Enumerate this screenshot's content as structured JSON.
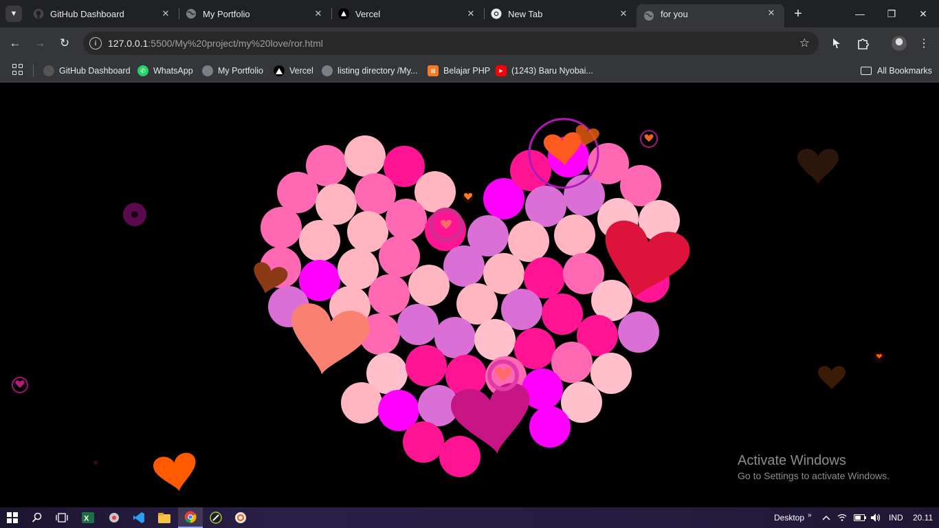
{
  "tabs": [
    {
      "title": "GitHub Dashboard",
      "icon": "github-icon",
      "active": false
    },
    {
      "title": "My Portfolio",
      "icon": "globe-icon",
      "active": false
    },
    {
      "title": "Vercel",
      "icon": "vercel-icon",
      "active": false
    },
    {
      "title": "New Tab",
      "icon": "chrome-icon",
      "active": false
    },
    {
      "title": "for you",
      "icon": "globe-icon",
      "active": true
    }
  ],
  "tab_close_glyph": "✕",
  "new_tab_glyph": "+",
  "window_controls": {
    "minimize": "—",
    "maximize": "❐",
    "close": "✕"
  },
  "toolbar": {
    "back_glyph": "←",
    "forward_glyph": "→",
    "reload_glyph": "↻",
    "url_host": "127.0.0.1",
    "url_rest": ":5500/My%20project/my%20love/ror.html",
    "star_glyph": "☆",
    "menu_glyph": "⋮",
    "site_info_glyph": "i"
  },
  "bookmarks": [
    {
      "label": "GitHub Dashboard",
      "icon": "github-icon"
    },
    {
      "label": "WhatsApp",
      "icon": "whatsapp-icon"
    },
    {
      "label": "My Portfolio",
      "icon": "globe-icon"
    },
    {
      "label": "Vercel",
      "icon": "vercel-icon"
    },
    {
      "label": "listing directory /My...",
      "icon": "globe-icon"
    },
    {
      "label": "Belajar PHP",
      "icon": "xampp-icon"
    },
    {
      "label": "(1243) Baru Nyobai...",
      "icon": "youtube-icon"
    }
  ],
  "all_bookmarks_label": "All Bookmarks",
  "watermark": {
    "title": "Activate Windows",
    "subtitle": "Go to Settings to activate Windows."
  },
  "taskbar": {
    "apps": [
      "windows-start-icon",
      "search-icon",
      "task-view-icon",
      "excel-icon",
      "app-icon",
      "vscode-icon",
      "file-explorer-icon",
      "chrome-icon",
      "app-icon",
      "app-icon"
    ],
    "desktop_label": "Desktop",
    "language": "IND",
    "time": "20.11"
  },
  "colors": {
    "tab_strip": "#202124",
    "toolbar": "#35363a",
    "page_bg": "#000000",
    "heart_palette": [
      "#ff1493",
      "#ff69b4",
      "#ffb6c1",
      "#ff00ff",
      "#da70d6",
      "#ffc0cb"
    ]
  }
}
